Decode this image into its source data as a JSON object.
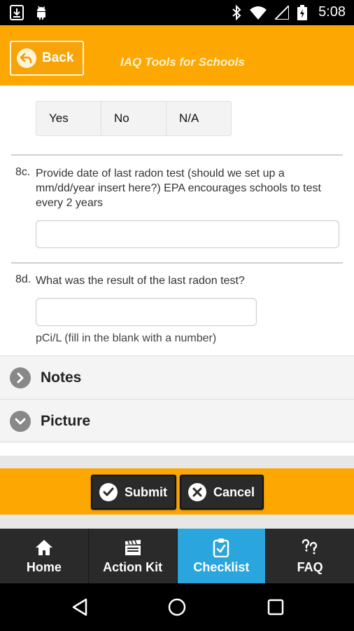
{
  "status_bar": {
    "time": "5:08",
    "icons": [
      "download-icon",
      "android-icon",
      "bluetooth-icon",
      "wifi-icon",
      "signal-icon",
      "battery-charging-icon"
    ]
  },
  "header": {
    "back_label": "Back",
    "title": "IAQ Tools for Schools"
  },
  "question_8b": {
    "options": [
      "Yes",
      "No",
      "N/A"
    ]
  },
  "question_8c": {
    "number": "8c.",
    "text": "Provide date of last radon test (should we set up a mm/dd/year insert here?) EPA encourages schools to test every 2 years",
    "value": ""
  },
  "question_8d": {
    "number": "8d.",
    "text": "What was the result of the last radon test?",
    "value": "",
    "unit_text": "pCi/L (fill in the blank with a number)"
  },
  "sections": [
    {
      "label": "Notes",
      "icon": "chevron-right-icon"
    },
    {
      "label": "Picture",
      "icon": "chevron-down-icon"
    }
  ],
  "actions": {
    "submit_label": "Submit",
    "cancel_label": "Cancel"
  },
  "tabs": [
    {
      "label": "Home",
      "icon": "home-icon",
      "active": false
    },
    {
      "label": "Action Kit",
      "icon": "clapperboard-icon",
      "active": false
    },
    {
      "label": "Checklist",
      "icon": "clipboard-check-icon",
      "active": true
    },
    {
      "label": "FAQ",
      "icon": "question-icon",
      "active": false
    }
  ],
  "colors": {
    "header_orange": "#fda703",
    "tab_active_blue": "#2aa5dd",
    "tab_bar_dark": "#2a2a2a"
  }
}
